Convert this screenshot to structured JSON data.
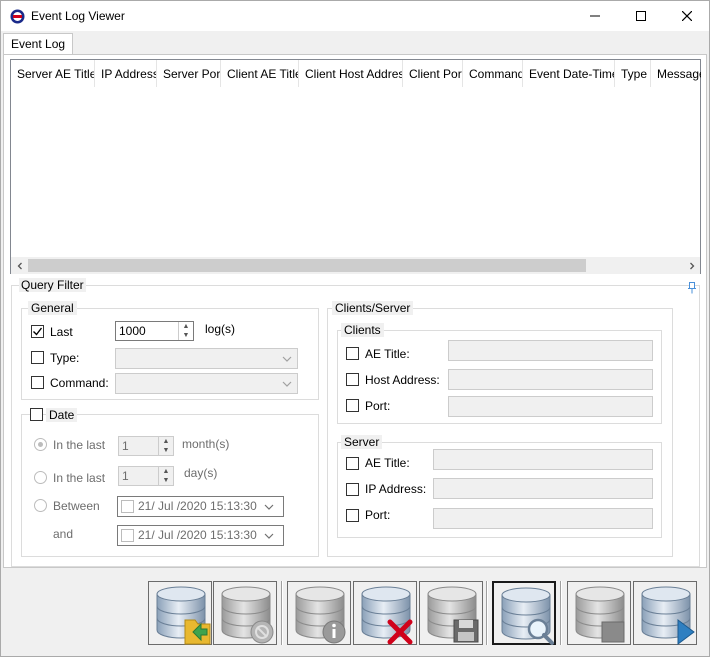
{
  "window": {
    "title": "Event Log Viewer"
  },
  "tabs": [
    {
      "label": "Event Log"
    }
  ],
  "log_table": {
    "columns": [
      "Server AE Title",
      "IP Address",
      "Server Port",
      "Client AE Title",
      "Client Host Address",
      "Client Port",
      "Command",
      "Event Date-Time",
      "Type",
      "Message"
    ],
    "rows": []
  },
  "query_filter": {
    "title": "Query Filter",
    "general": {
      "title": "General",
      "last_label": "Last",
      "last_checked": true,
      "last_value": "1000",
      "last_unit": "log(s)",
      "type_label": "Type:",
      "command_label": "Command:"
    },
    "date": {
      "title": "Date",
      "in_the_last_label": "In the last",
      "months_value": "1",
      "months_unit": "month(s)",
      "days_value": "1",
      "days_unit": "day(s)",
      "between_label": "Between",
      "and_label": "and",
      "from_date": "21/ Jul /2020 15:13:30",
      "to_date": "21/ Jul /2020 15:13:30"
    },
    "clients_server": {
      "title": "Clients/Server",
      "clients": {
        "title": "Clients",
        "ae_title_label": "AE Title:",
        "host_address_label": "Host Address:",
        "port_label": "Port:"
      },
      "server": {
        "title": "Server",
        "ae_title_label": "AE Title:",
        "ip_address_label": "IP Address:",
        "port_label": "Port:"
      }
    }
  },
  "toolbar": {
    "buttons": [
      {
        "icon": "database-open-icon",
        "enabled": true
      },
      {
        "icon": "database-disconnect-icon",
        "enabled": false
      },
      {
        "icon": "database-info-icon",
        "enabled": false
      },
      {
        "icon": "database-delete-icon",
        "enabled": true
      },
      {
        "icon": "database-save-icon",
        "enabled": false
      },
      {
        "icon": "database-search-icon",
        "enabled": true
      },
      {
        "icon": "database-stop-icon",
        "enabled": false
      },
      {
        "icon": "database-play-icon",
        "enabled": true
      }
    ]
  },
  "colors": {
    "accent_red": "#d0021b",
    "accent_blue": "#2f7fc1",
    "folder_yellow": "#e8b830"
  }
}
